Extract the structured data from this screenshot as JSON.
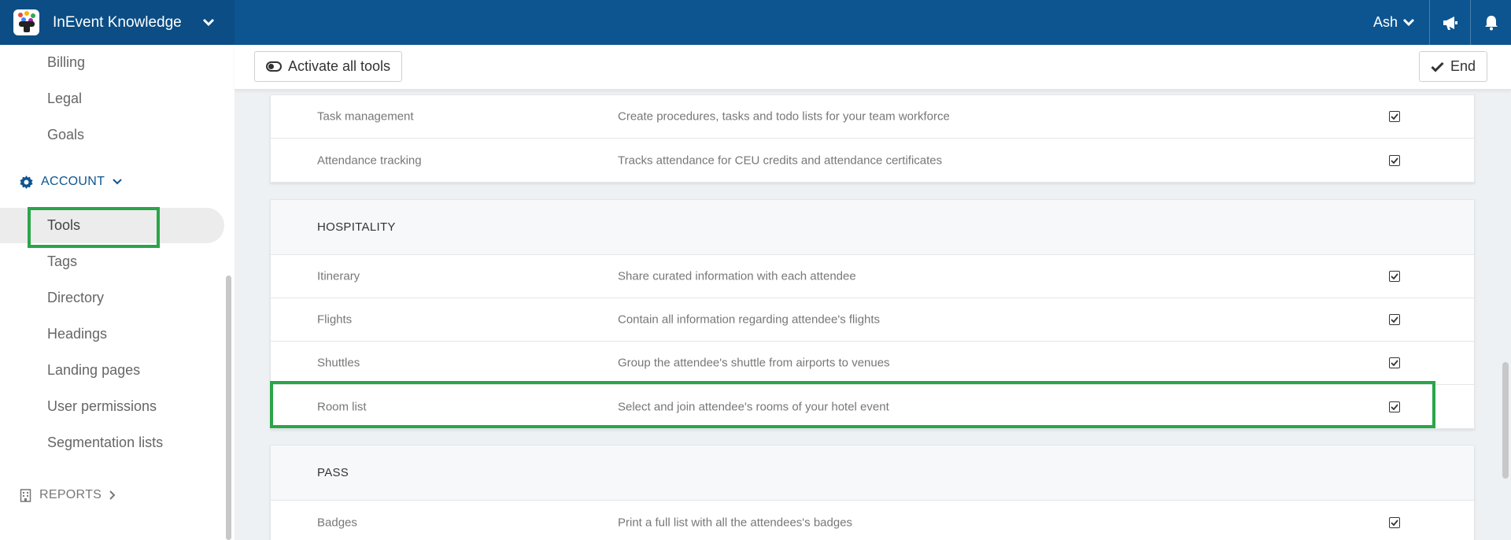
{
  "header": {
    "app_title": "InEvent Knowledge",
    "user_name": "Ash"
  },
  "sidebar": {
    "items_top": [
      {
        "label": "Billing"
      },
      {
        "label": "Legal"
      },
      {
        "label": "Goals"
      }
    ],
    "account_section": {
      "label": "ACCOUNT"
    },
    "items_account": [
      {
        "label": "Tools",
        "active": true
      },
      {
        "label": "Tags"
      },
      {
        "label": "Directory"
      },
      {
        "label": "Headings"
      },
      {
        "label": "Landing pages"
      },
      {
        "label": "User permissions"
      },
      {
        "label": "Segmentation lists"
      }
    ],
    "reports_section": {
      "label": "REPORTS"
    }
  },
  "toolbar": {
    "activate_label": "Activate all tools",
    "end_label": "End"
  },
  "sections": [
    {
      "title": "",
      "rows": [
        {
          "name": "Task management",
          "description": "Create procedures, tasks and todo lists for your team workforce",
          "checked": true
        },
        {
          "name": "Attendance tracking",
          "description": "Tracks attendance for CEU credits and attendance certificates",
          "checked": true
        }
      ]
    },
    {
      "title": "HOSPITALITY",
      "rows": [
        {
          "name": "Itinerary",
          "description": "Share curated information with each attendee",
          "checked": true
        },
        {
          "name": "Flights",
          "description": "Contain all information regarding attendee's flights",
          "checked": true
        },
        {
          "name": "Shuttles",
          "description": "Group the attendee's shuttle from airports to venues",
          "checked": true
        },
        {
          "name": "Room list",
          "description": "Select and join attendee's rooms of your hotel event",
          "checked": true
        }
      ]
    },
    {
      "title": "PASS",
      "rows": [
        {
          "name": "Badges",
          "description": "Print a full list with all the attendees's badges",
          "checked": true
        }
      ]
    }
  ],
  "colors": {
    "topbar": "#0d5591",
    "brand_bg": "#0b4d84",
    "highlight": "#2aa54a",
    "accent": "#0d5591"
  }
}
